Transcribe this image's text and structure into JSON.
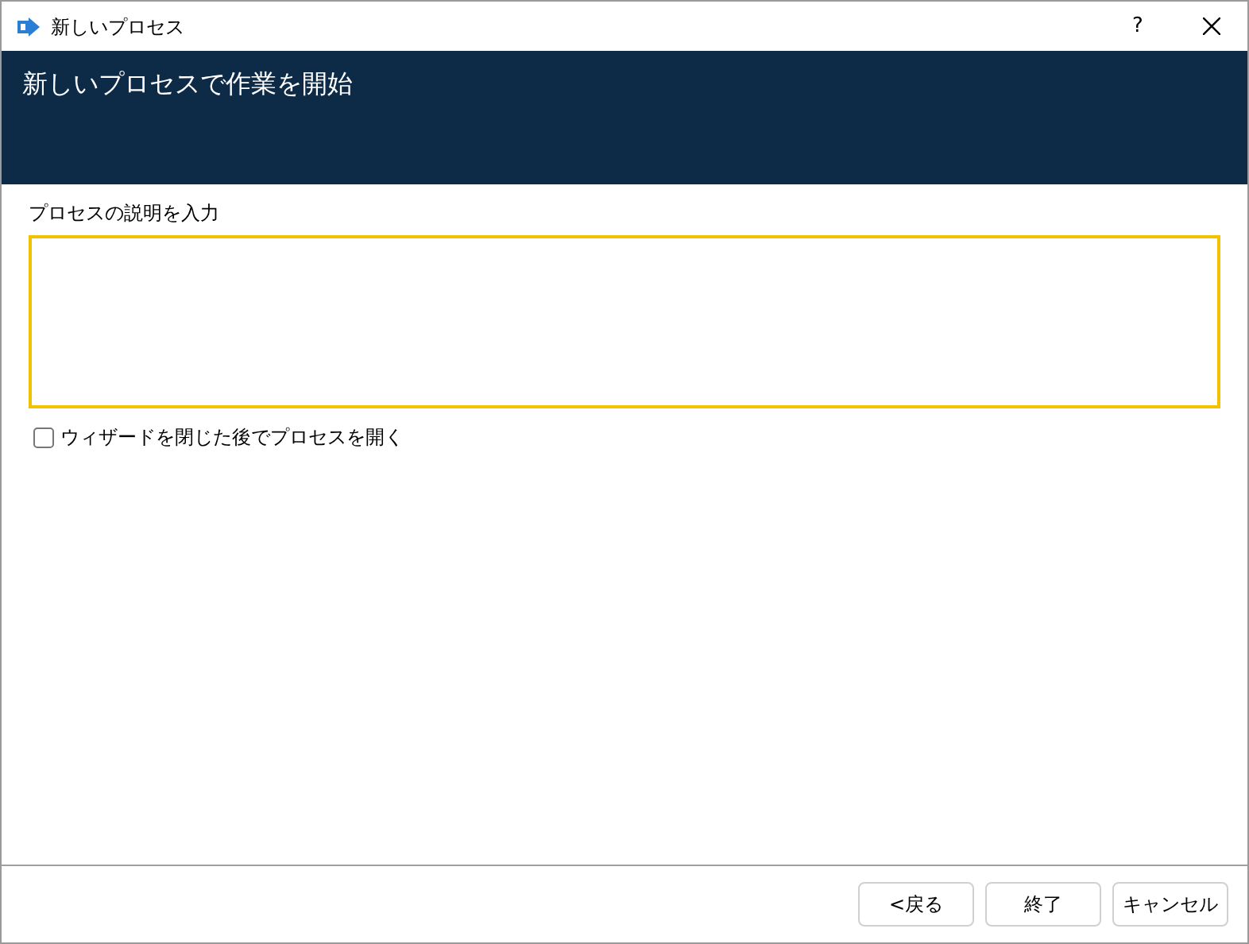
{
  "window": {
    "title": "新しいプロセス",
    "help": "?"
  },
  "header": {
    "title": "新しいプロセスで作業を開始"
  },
  "description": {
    "label": "プロセスの説明を入力",
    "focused": true
  },
  "open_after": {
    "label": "ウィザードを閉じた後でプロセスを開く",
    "checked": false
  },
  "buttons": [
    {
      "label": "<戻る"
    },
    {
      "label": "終了"
    },
    {
      "label": "キャンセル"
    }
  ]
}
